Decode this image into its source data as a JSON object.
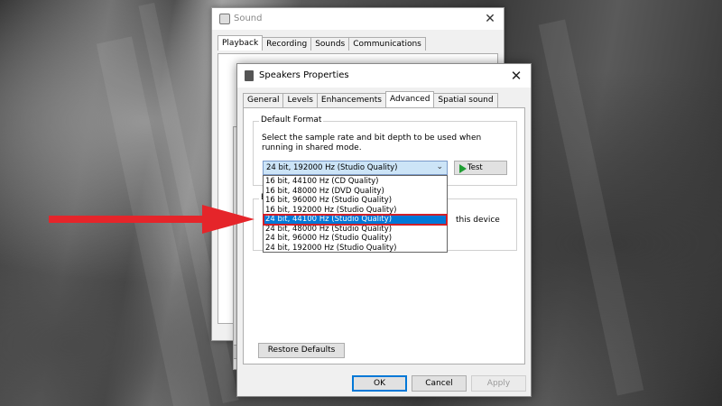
{
  "sound_window": {
    "title": "Sound",
    "close_glyph": "✕",
    "tabs": [
      {
        "label": "Playback"
      },
      {
        "label": "Recording"
      },
      {
        "label": "Sounds"
      },
      {
        "label": "Communications"
      }
    ]
  },
  "props_window": {
    "title": "Speakers Properties",
    "close_glyph": "✕",
    "tabs": [
      {
        "label": "General"
      },
      {
        "label": "Levels"
      },
      {
        "label": "Enhancements"
      },
      {
        "label": "Advanced"
      },
      {
        "label": "Spatial sound"
      }
    ],
    "default_format": {
      "group_label": "Default Format",
      "description": "Select the sample rate and bit depth to be used when running in shared mode.",
      "selected_value": "24 bit, 192000 Hz (Studio Quality)",
      "test_label": "Test",
      "options": [
        "16 bit, 44100 Hz (CD Quality)",
        "16 bit, 48000 Hz (DVD Quality)",
        "16 bit, 96000 Hz (Studio Quality)",
        "16 bit, 192000 Hz (Studio Quality)",
        "24 bit, 44100 Hz (Studio Quality)",
        "24 bit, 48000 Hz (Studio Quality)",
        "24 bit, 96000 Hz (Studio Quality)",
        "24 bit, 192000 Hz (Studio Quality)"
      ],
      "highlighted_option": "24 bit, 44100 Hz (Studio Quality)"
    },
    "exclusive_mode": {
      "label_visible": "E",
      "partial_text": "this device"
    },
    "restore_label": "Restore Defaults",
    "ok_label": "OK",
    "cancel_label": "Cancel",
    "apply_label": "Apply"
  },
  "colors": {
    "accent": "#0078d7",
    "highlight_outline": "#d22027",
    "arrow": "#e5252a",
    "test_play": "#1f9d32"
  }
}
